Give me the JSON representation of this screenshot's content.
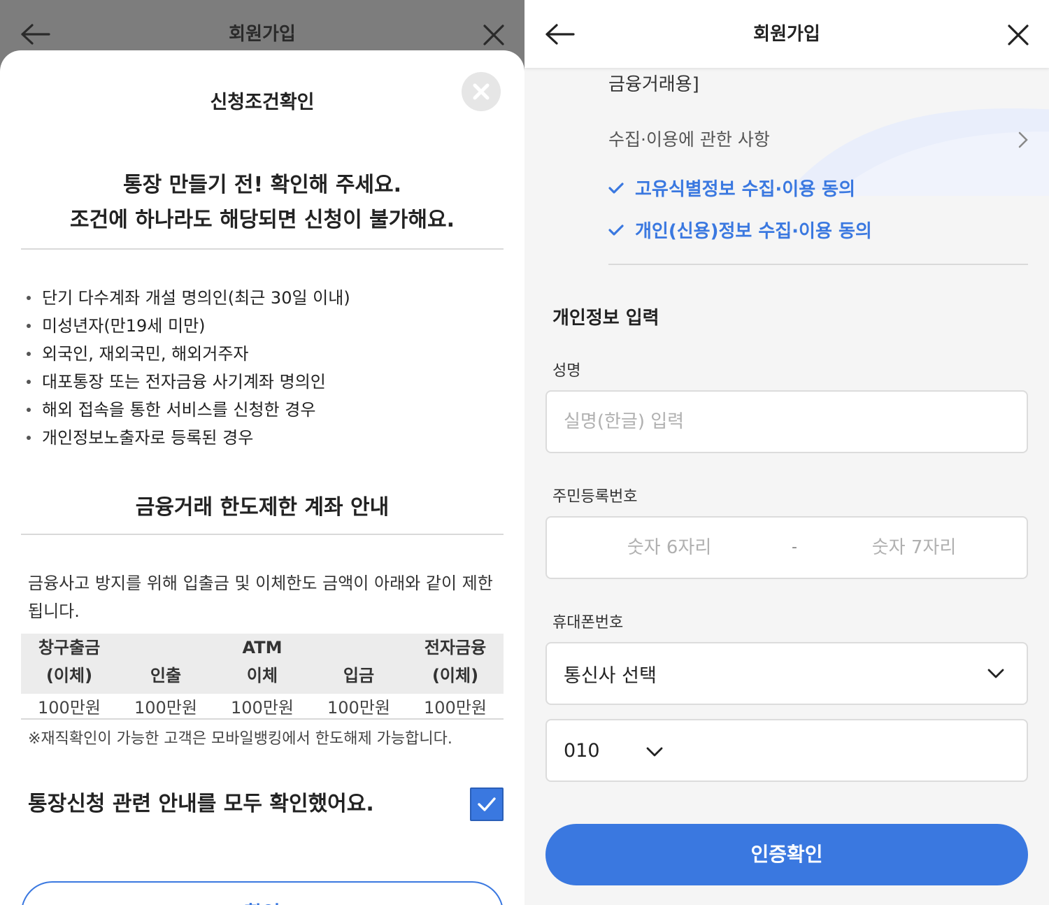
{
  "left": {
    "header": {
      "title": "회원가입"
    },
    "sheet": {
      "title": "신청조건확인",
      "headline_line1": "통장 만들기 전! 확인해 주세요.",
      "headline_line2": "조건에 하나라도 해당되면 신청이 불가해요.",
      "conditions": [
        "단기 다수계좌 개설 명의인(최근 30일 이내)",
        "미성년자(만19세 미만)",
        "외국인, 재외국민, 해외거주자",
        "대포통장 또는 전자금융 사기계좌 명의인",
        "해외 접속을 통한 서비스를 신청한 경우",
        "개인정보노출자로 등록된 경우"
      ],
      "limit_title": "금융거래 한도제한 계좌 안내",
      "limit_desc": "금융사고 방지를 위해 입출금 및 이체한도 금액이 아래와 같이 제한됩니다.",
      "limit_table": {
        "headers": [
          {
            "line1": "창구출금",
            "line2": "(이체)"
          },
          {
            "line1": "",
            "line2": "인출"
          },
          {
            "line1": "ATM",
            "line2": "이체"
          },
          {
            "line1": "",
            "line2": "입금"
          },
          {
            "line1": "전자금융",
            "line2": "(이체)"
          }
        ],
        "values": [
          "100만원",
          "100만원",
          "100만원",
          "100만원",
          "100만원"
        ]
      },
      "limit_note": "※재직확인이 가능한 고객은 모바일뱅킹에서 한도해제 가능합니다.",
      "confirm_text": "통장신청 관련 안내를 모두 확인했어요.",
      "confirm_checked": true,
      "confirm_button": "확인"
    }
  },
  "right": {
    "header": {
      "title": "회원가입"
    },
    "cut_text": "금융거래용]",
    "collect_link": "수집·이용에 관한 사항",
    "agreements": [
      "고유식별정보 수집·이용 동의",
      "개인(신용)정보 수집·이용 동의"
    ],
    "section_title": "개인정보 입력",
    "name": {
      "label": "성명",
      "placeholder": "실명(한글) 입력"
    },
    "rrn": {
      "label": "주민등록번호",
      "front_placeholder": "숫자 6자리",
      "separator": "-",
      "back_placeholder": "숫자 7자리"
    },
    "phone": {
      "label": "휴대폰번호",
      "carrier_selected": "통신사 선택",
      "prefix_selected": "010"
    },
    "verify_button": "인증확인"
  },
  "colors": {
    "accent": "#3a78e0",
    "overlay": "#7d7d7d",
    "background": "#f5f5f5"
  }
}
